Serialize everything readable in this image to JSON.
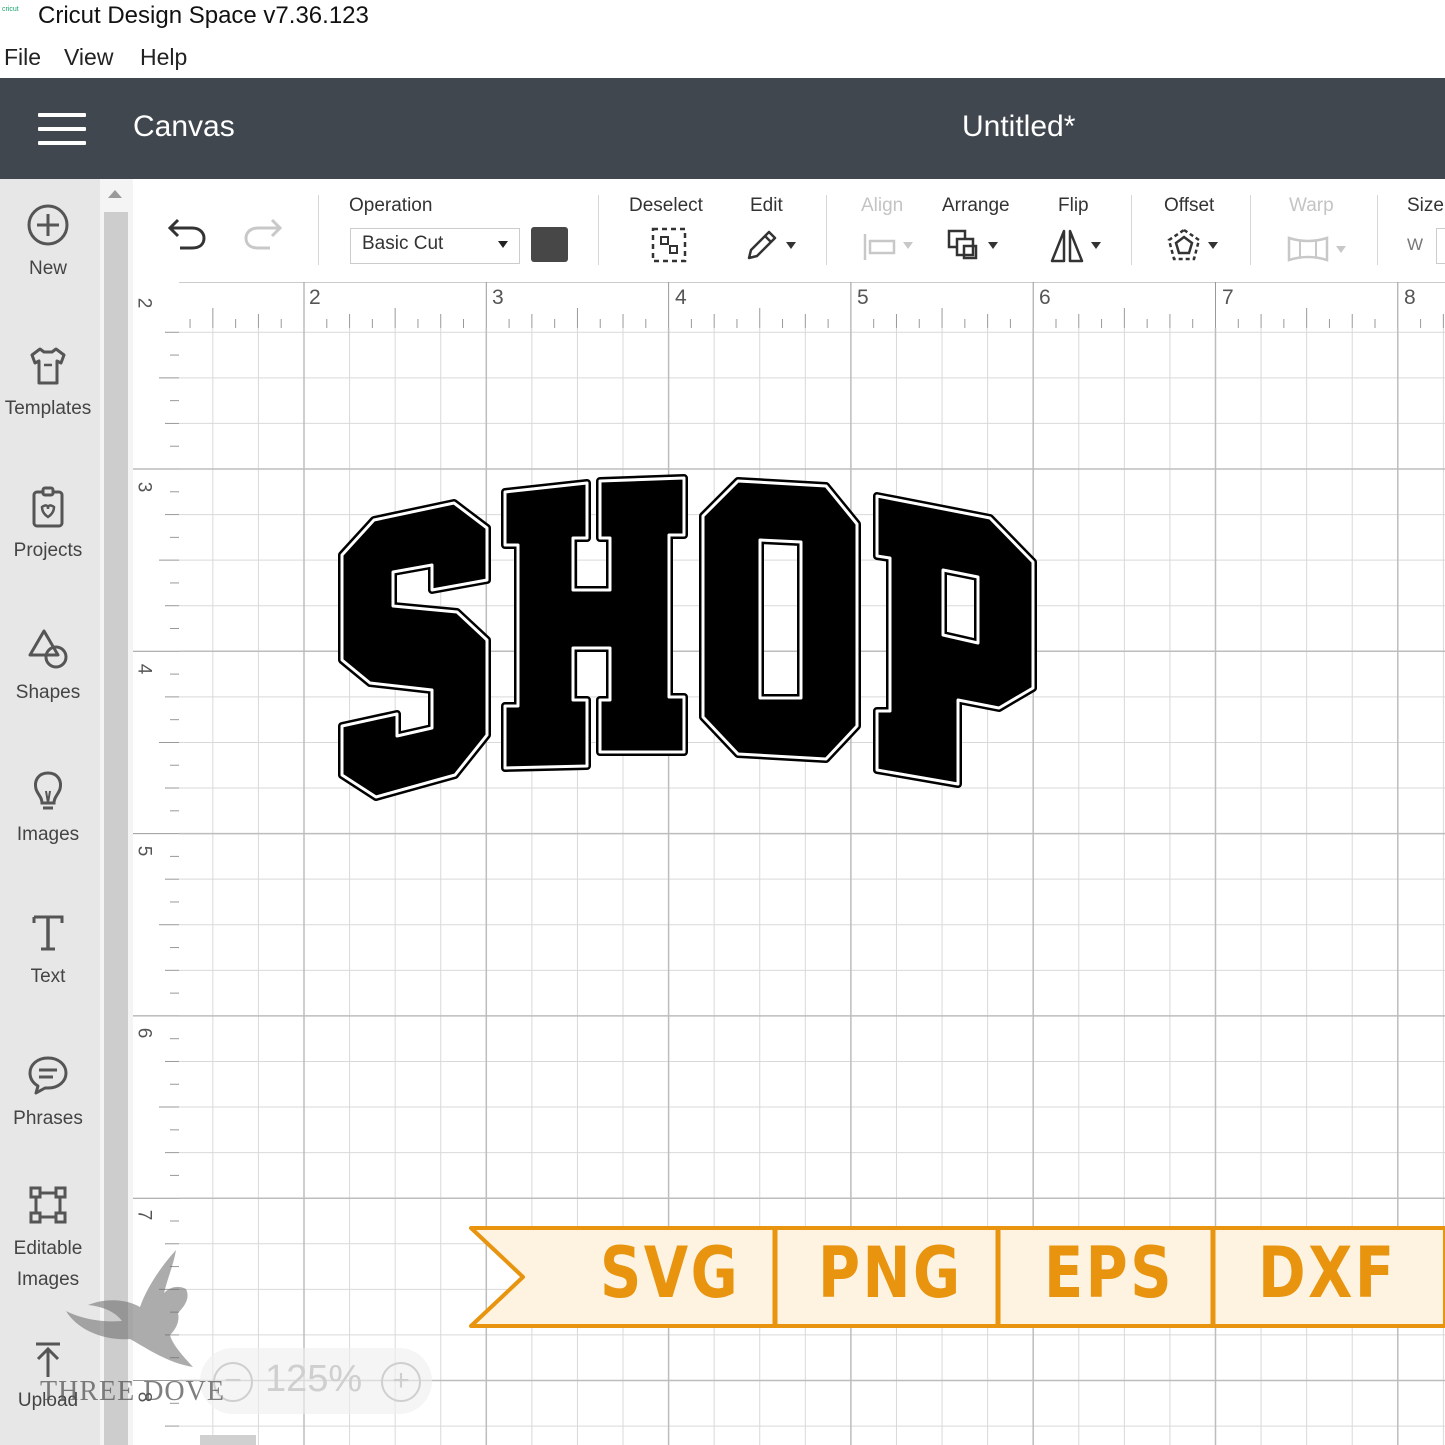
{
  "window": {
    "title": "Cricut Design Space  v7.36.123",
    "logo_text": "cricut"
  },
  "menu": [
    "File",
    "View",
    "Help"
  ],
  "header": {
    "section": "Canvas",
    "document_title": "Untitled*"
  },
  "sidebar": {
    "items": [
      {
        "label": "New",
        "icon": "plus-circle-icon"
      },
      {
        "label": "Templates",
        "icon": "tshirt-icon"
      },
      {
        "label": "Projects",
        "icon": "project-icon"
      },
      {
        "label": "Shapes",
        "icon": "shapes-icon"
      },
      {
        "label": "Images",
        "icon": "lightbulb-icon"
      },
      {
        "label": "Text",
        "icon": "text-icon"
      },
      {
        "label": "Phrases",
        "icon": "speech-bubble-icon"
      },
      {
        "label": "Editable Images",
        "icon": "editable-image-icon"
      },
      {
        "label": "Upload",
        "icon": "upload-icon"
      }
    ]
  },
  "toolbar": {
    "operation_label": "Operation",
    "operation_value": "Basic Cut",
    "operation_color": "#474747",
    "deselect_label": "Deselect",
    "edit_label": "Edit",
    "align_label": "Align",
    "arrange_label": "Arrange",
    "flip_label": "Flip",
    "offset_label": "Offset",
    "warp_label": "Warp",
    "size_label": "Size",
    "size_w_label": "W"
  },
  "rulers": {
    "top": [
      "2",
      "3",
      "4",
      "5",
      "6",
      "7",
      "8"
    ],
    "left": [
      "2",
      "3",
      "4",
      "5",
      "6",
      "7",
      "8"
    ]
  },
  "canvas": {
    "artwork_text": "SHOP"
  },
  "banner": {
    "formats": [
      "SVG",
      "PNG",
      "EPS",
      "DXF"
    ],
    "text_color": "#e8940f",
    "background_color": "#fdf3e0"
  },
  "zoom": {
    "value": "125%",
    "minus": "−",
    "plus": "+"
  },
  "watermark": {
    "text": "THREE DOVE"
  }
}
